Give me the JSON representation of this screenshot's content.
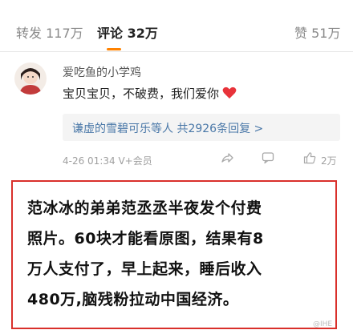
{
  "tabs": {
    "repost": "转发 117万",
    "comment": "评论 32万",
    "like": "赞 51万"
  },
  "comment": {
    "username": "爱吃鱼的小学鸡",
    "text": "宝贝宝贝，不破费，我们爱你",
    "reply_summary": "谦虚的雪碧可乐等人 共2926条回复 >",
    "meta": "4-26 01:34 V+会员",
    "like_count": "2万"
  },
  "caption": {
    "lines": [
      "范冰冰的弟弟范丞丞半夜发个付费",
      "照片。60块才能看原图，结果有8",
      "万人支付了，早上起来，睡后收入",
      "480万,脑残粉拉动中国经济。"
    ]
  },
  "watermark": "@IHE",
  "colors": {
    "accent": "#ff8200",
    "link": "#4a78a8",
    "frame": "#d9302b",
    "heart": "#e8333a"
  },
  "icons": {
    "heart": "red-heart-icon",
    "share": "share-icon",
    "comment": "comment-icon",
    "like": "thumbs-up-icon"
  }
}
